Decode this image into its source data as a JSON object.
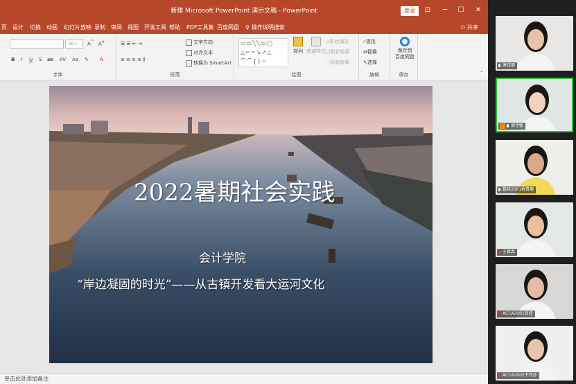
{
  "window": {
    "title": "新建 Microsoft PowerPoint 演示文稿 - PowerPoint",
    "signin_label": "登录",
    "minimize": "─",
    "maximize": "☐",
    "close": "✕",
    "ribbon_options": "⊡"
  },
  "menu": {
    "tabs": [
      "页",
      "设计",
      "切换",
      "动画",
      "幻灯片放映",
      "录制",
      "审阅",
      "视图",
      "开发工具",
      "帮助",
      "PDF工具集",
      "百度网盘",
      "操作说明搜索"
    ],
    "share": "共享"
  },
  "ribbon": {
    "font_group_label": "字体",
    "font_size": "36+",
    "font_buttons": [
      "B",
      "I",
      "U",
      "S",
      "ab",
      "AV",
      "Aa",
      "A"
    ],
    "paragraph_group_label": "段落",
    "text_direction": "文字方向",
    "align_text": "对齐文本",
    "convert_smartart": "转换为 SmartArt",
    "drawing_group_label": "绘图",
    "arrange": "排列",
    "quick_styles": "快速样式",
    "shape_fill": "形状填充",
    "shape_outline": "形状轮廓",
    "shape_effects": "形状效果",
    "editing_group_label": "编辑",
    "find": "查找",
    "replace": "替换",
    "select": "选择",
    "save_group_label": "保存",
    "save_to_baidu": "保存到\n百度网盘"
  },
  "slide": {
    "title": "2022暑期社会实践",
    "subtitle1": "会计学院",
    "subtitle2": "“岸边凝固的时光”——从古镇开发看大运河文化"
  },
  "status": {
    "notes_hint": "单击此处添加备注"
  },
  "participants": [
    {
      "name": "唐佳丽",
      "bg": "#e9e6e6",
      "skin": "#e8c3aa"
    },
    {
      "name": "周佳敏",
      "bg": "#dfe7e4",
      "skin": "#f0d2bd"
    },
    {
      "name": "数经2001程青鹿",
      "bg": "#eeeeea",
      "skin": "#d9a98c"
    },
    {
      "name": "于真真",
      "bg": "#e4e8e4",
      "skin": "#e7c0a2"
    },
    {
      "name": "ACCA2001负佳",
      "bg": "#d9d6d6",
      "skin": "#e4bca6"
    },
    {
      "name": "ACCA2002王司亦",
      "bg": "#efefef",
      "skin": "#e6c4ad"
    }
  ],
  "colors": {
    "ppt_accent": "#b7472a"
  }
}
